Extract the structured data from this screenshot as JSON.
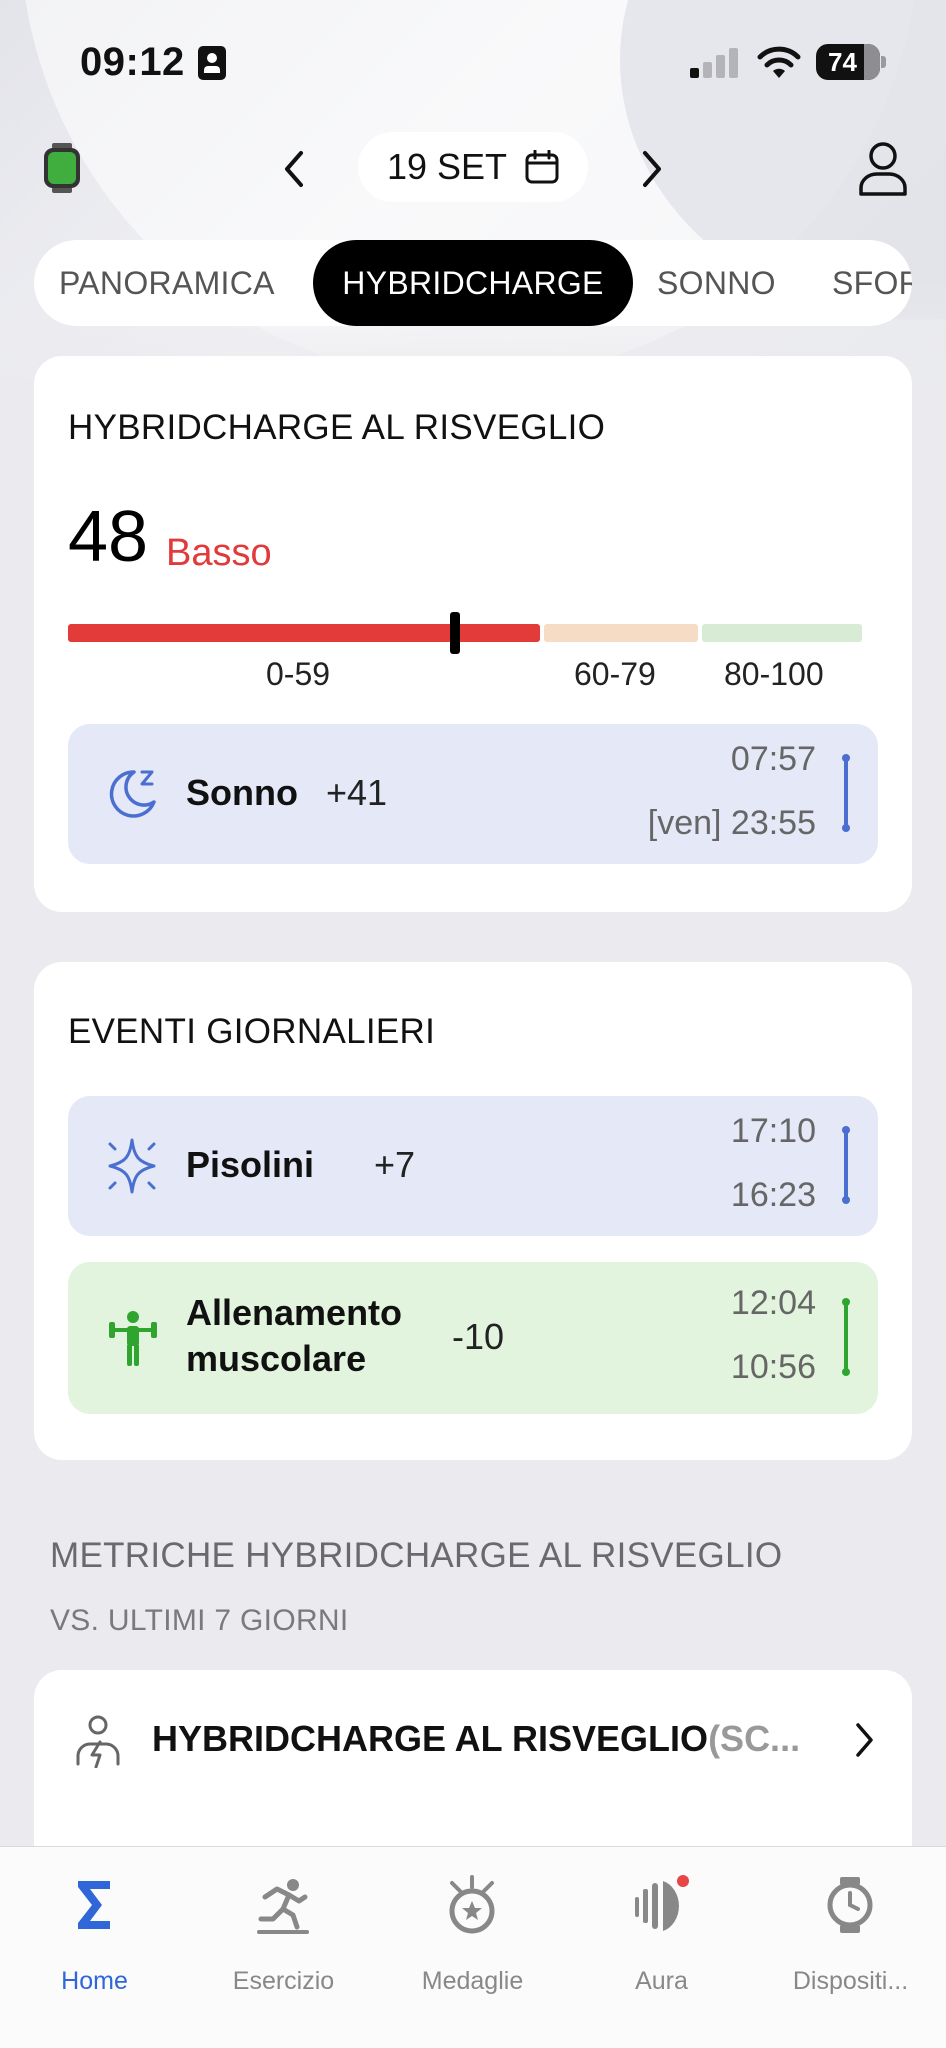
{
  "status_bar": {
    "time": "09:12",
    "battery": "74"
  },
  "header": {
    "date": "19 SET"
  },
  "tabs": [
    {
      "label": "PANORAMICA",
      "active": false
    },
    {
      "label": "HYBRIDCHARGE",
      "active": true
    },
    {
      "label": "SONNO",
      "active": false
    },
    {
      "label": "SFOR",
      "active": false
    }
  ],
  "wake_card": {
    "title": "HYBRIDCHARGE AL RISVEGLIO",
    "score": "48",
    "score_label": "Basso",
    "score_value": 48,
    "ranges": [
      "0-59",
      "60-79",
      "80-100"
    ],
    "colors": {
      "low": "#e33a3a",
      "mid": "#f6dcc4",
      "high": "#d8ecd5"
    },
    "sleep_row": {
      "name": "Sonno",
      "delta": "+41",
      "time_end": "07:57",
      "time_start": "[ven] 23:55"
    }
  },
  "events_card": {
    "title": "EVENTI GIORNALIERI",
    "rows": [
      {
        "name": "Pisolini",
        "delta": "+7",
        "time_end": "17:10",
        "time_start": "16:23"
      },
      {
        "name_line1": "Allenamento",
        "name_line2": "muscolare",
        "delta": "-10",
        "time_end": "12:04",
        "time_start": "10:56"
      }
    ]
  },
  "metrics": {
    "title": "METRICHE HYBRIDCHARGE AL RISVEGLIO",
    "subtitle": "VS. ULTIMI 7 GIORNI",
    "item_title": "HYBRIDCHARGE AL RISVEGLIO",
    "item_suffix": "(SC..."
  },
  "bottom_nav": [
    {
      "label": "Home",
      "icon": "sigma-icon",
      "active": true
    },
    {
      "label": "Esercizio",
      "icon": "runner-icon",
      "active": false
    },
    {
      "label": "Medaglie",
      "icon": "medal-icon",
      "active": false
    },
    {
      "label": "Aura",
      "icon": "aura-icon",
      "active": false
    },
    {
      "label": "Dispositi...",
      "icon": "watch-icon",
      "active": false
    }
  ]
}
